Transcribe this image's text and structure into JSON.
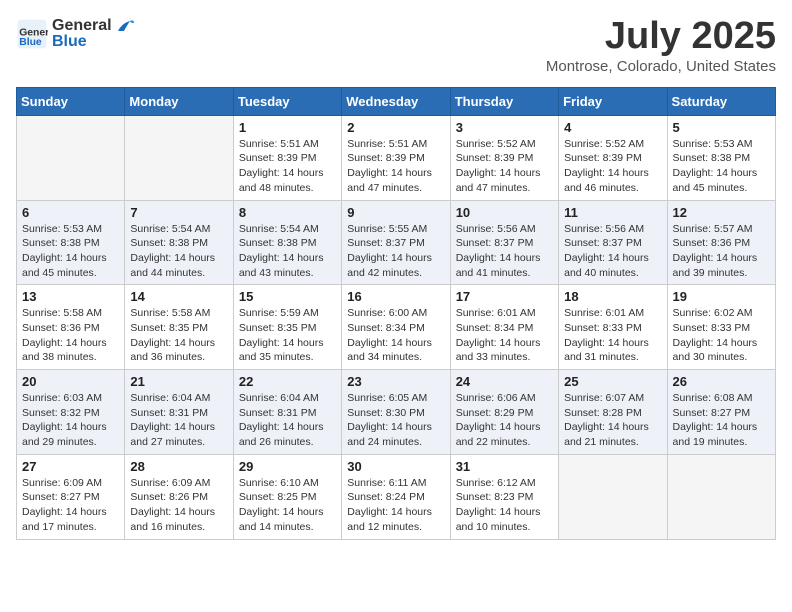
{
  "header": {
    "logo_line1": "General",
    "logo_line2": "Blue",
    "month_year": "July 2025",
    "location": "Montrose, Colorado, United States"
  },
  "days_of_week": [
    "Sunday",
    "Monday",
    "Tuesday",
    "Wednesday",
    "Thursday",
    "Friday",
    "Saturday"
  ],
  "weeks": [
    [
      {
        "day": "",
        "info": ""
      },
      {
        "day": "",
        "info": ""
      },
      {
        "day": "1",
        "info": "Sunrise: 5:51 AM\nSunset: 8:39 PM\nDaylight: 14 hours\nand 48 minutes."
      },
      {
        "day": "2",
        "info": "Sunrise: 5:51 AM\nSunset: 8:39 PM\nDaylight: 14 hours\nand 47 minutes."
      },
      {
        "day": "3",
        "info": "Sunrise: 5:52 AM\nSunset: 8:39 PM\nDaylight: 14 hours\nand 47 minutes."
      },
      {
        "day": "4",
        "info": "Sunrise: 5:52 AM\nSunset: 8:39 PM\nDaylight: 14 hours\nand 46 minutes."
      },
      {
        "day": "5",
        "info": "Sunrise: 5:53 AM\nSunset: 8:38 PM\nDaylight: 14 hours\nand 45 minutes."
      }
    ],
    [
      {
        "day": "6",
        "info": "Sunrise: 5:53 AM\nSunset: 8:38 PM\nDaylight: 14 hours\nand 45 minutes."
      },
      {
        "day": "7",
        "info": "Sunrise: 5:54 AM\nSunset: 8:38 PM\nDaylight: 14 hours\nand 44 minutes."
      },
      {
        "day": "8",
        "info": "Sunrise: 5:54 AM\nSunset: 8:38 PM\nDaylight: 14 hours\nand 43 minutes."
      },
      {
        "day": "9",
        "info": "Sunrise: 5:55 AM\nSunset: 8:37 PM\nDaylight: 14 hours\nand 42 minutes."
      },
      {
        "day": "10",
        "info": "Sunrise: 5:56 AM\nSunset: 8:37 PM\nDaylight: 14 hours\nand 41 minutes."
      },
      {
        "day": "11",
        "info": "Sunrise: 5:56 AM\nSunset: 8:37 PM\nDaylight: 14 hours\nand 40 minutes."
      },
      {
        "day": "12",
        "info": "Sunrise: 5:57 AM\nSunset: 8:36 PM\nDaylight: 14 hours\nand 39 minutes."
      }
    ],
    [
      {
        "day": "13",
        "info": "Sunrise: 5:58 AM\nSunset: 8:36 PM\nDaylight: 14 hours\nand 38 minutes."
      },
      {
        "day": "14",
        "info": "Sunrise: 5:58 AM\nSunset: 8:35 PM\nDaylight: 14 hours\nand 36 minutes."
      },
      {
        "day": "15",
        "info": "Sunrise: 5:59 AM\nSunset: 8:35 PM\nDaylight: 14 hours\nand 35 minutes."
      },
      {
        "day": "16",
        "info": "Sunrise: 6:00 AM\nSunset: 8:34 PM\nDaylight: 14 hours\nand 34 minutes."
      },
      {
        "day": "17",
        "info": "Sunrise: 6:01 AM\nSunset: 8:34 PM\nDaylight: 14 hours\nand 33 minutes."
      },
      {
        "day": "18",
        "info": "Sunrise: 6:01 AM\nSunset: 8:33 PM\nDaylight: 14 hours\nand 31 minutes."
      },
      {
        "day": "19",
        "info": "Sunrise: 6:02 AM\nSunset: 8:33 PM\nDaylight: 14 hours\nand 30 minutes."
      }
    ],
    [
      {
        "day": "20",
        "info": "Sunrise: 6:03 AM\nSunset: 8:32 PM\nDaylight: 14 hours\nand 29 minutes."
      },
      {
        "day": "21",
        "info": "Sunrise: 6:04 AM\nSunset: 8:31 PM\nDaylight: 14 hours\nand 27 minutes."
      },
      {
        "day": "22",
        "info": "Sunrise: 6:04 AM\nSunset: 8:31 PM\nDaylight: 14 hours\nand 26 minutes."
      },
      {
        "day": "23",
        "info": "Sunrise: 6:05 AM\nSunset: 8:30 PM\nDaylight: 14 hours\nand 24 minutes."
      },
      {
        "day": "24",
        "info": "Sunrise: 6:06 AM\nSunset: 8:29 PM\nDaylight: 14 hours\nand 22 minutes."
      },
      {
        "day": "25",
        "info": "Sunrise: 6:07 AM\nSunset: 8:28 PM\nDaylight: 14 hours\nand 21 minutes."
      },
      {
        "day": "26",
        "info": "Sunrise: 6:08 AM\nSunset: 8:27 PM\nDaylight: 14 hours\nand 19 minutes."
      }
    ],
    [
      {
        "day": "27",
        "info": "Sunrise: 6:09 AM\nSunset: 8:27 PM\nDaylight: 14 hours\nand 17 minutes."
      },
      {
        "day": "28",
        "info": "Sunrise: 6:09 AM\nSunset: 8:26 PM\nDaylight: 14 hours\nand 16 minutes."
      },
      {
        "day": "29",
        "info": "Sunrise: 6:10 AM\nSunset: 8:25 PM\nDaylight: 14 hours\nand 14 minutes."
      },
      {
        "day": "30",
        "info": "Sunrise: 6:11 AM\nSunset: 8:24 PM\nDaylight: 14 hours\nand 12 minutes."
      },
      {
        "day": "31",
        "info": "Sunrise: 6:12 AM\nSunset: 8:23 PM\nDaylight: 14 hours\nand 10 minutes."
      },
      {
        "day": "",
        "info": ""
      },
      {
        "day": "",
        "info": ""
      }
    ]
  ]
}
